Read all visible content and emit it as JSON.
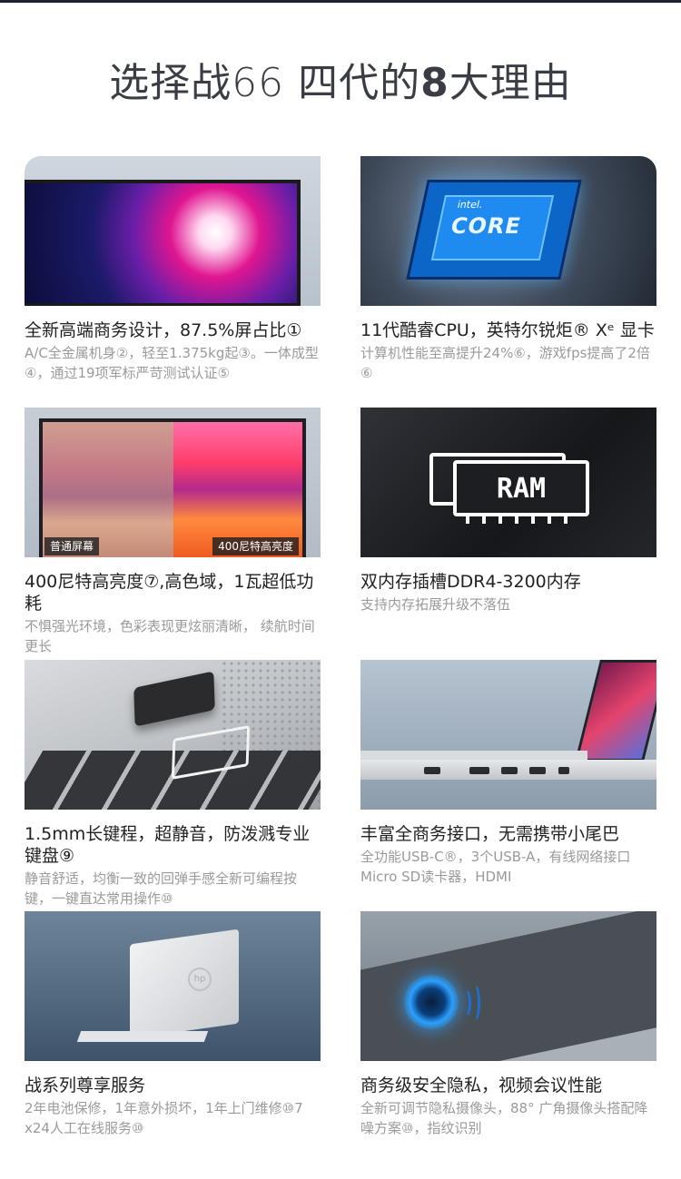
{
  "headline": {
    "prefix": "选择战66 四代的",
    "highlight": "8",
    "suffix": "大理由"
  },
  "cards": [
    {
      "title": "全新高端商务设计，87.5%屏占比①",
      "desc": "A/C全金属机身②，轻至1.375kg起③。一体成型④，通过19项军标严苛测试认证⑤"
    },
    {
      "title": "11代酷睿CPU，英特尔锐炬® Xᵉ 显卡",
      "desc": "计算机性能至高提升24%⑥，游戏fps提高了2倍⑥",
      "chip_brand": "intel.",
      "chip_text": "CORE"
    },
    {
      "title": "400尼特高亮度⑦,高色域，1瓦超低功耗",
      "desc": "不惧强光环境，色彩表现更炫丽清晰， 续航时间更长",
      "tag_left": "普通屏幕",
      "tag_right": "400尼特高亮度"
    },
    {
      "title": "双内存插槽DDR4-3200内存",
      "desc": "支持内存拓展升级不落伍",
      "ram_text": "RAM"
    },
    {
      "title": "1.5mm长键程，超静音，防泼溅专业键盘⑨",
      "desc": "静音舒适，均衡一致的回弹手感全新可编程按键，一键直达常用操作⑩"
    },
    {
      "title": "丰富全商务接口，无需携带小尾巴",
      "desc": "全功能USB-C®，3个USB-A，有线网络接口Micro SD读卡器，HDMI"
    },
    {
      "title": "战系列尊享服务",
      "desc": "2年电池保修，1年意外损坏，1年上门维修⑩7 x24人工在线服务⑩",
      "logo_text": "hp"
    },
    {
      "title": "商务级安全隐私，视频会议性能",
      "desc": "全新可调节隐私摄像头，88° 广角摄像头搭配降噪方案⑩，指纹识别"
    }
  ]
}
